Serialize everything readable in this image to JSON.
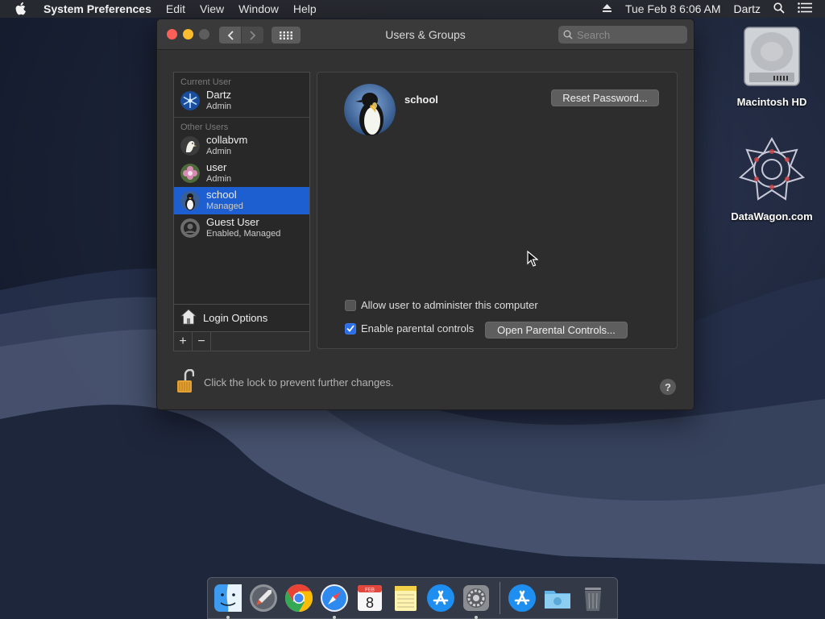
{
  "menubar": {
    "app_name": "System Preferences",
    "menus": [
      "Edit",
      "View",
      "Window",
      "Help"
    ],
    "datetime": "Tue Feb 8  6:06 AM",
    "username": "Dartz"
  },
  "window": {
    "title": "Users & Groups",
    "search_placeholder": "Search"
  },
  "sidebar": {
    "current_header": "Current User",
    "current_user": {
      "name": "Dartz",
      "role": "Admin"
    },
    "other_header": "Other Users",
    "other_users": [
      {
        "name": "collabvm",
        "role": "Admin"
      },
      {
        "name": "user",
        "role": "Admin"
      },
      {
        "name": "school",
        "role": "Managed"
      },
      {
        "name": "Guest User",
        "role": "Enabled, Managed"
      }
    ],
    "login_options": "Login Options",
    "add_label": "+",
    "remove_label": "−"
  },
  "detail": {
    "user_name": "school",
    "reset_password": "Reset Password...",
    "allow_admin_label": "Allow user to administer this computer",
    "allow_admin_checked": false,
    "parental_label": "Enable parental controls",
    "parental_checked": true,
    "open_parental": "Open Parental Controls..."
  },
  "lock": {
    "text": "Click the lock to prevent further changes."
  },
  "help": "?",
  "desktop": {
    "icons": [
      {
        "label": "Macintosh HD"
      },
      {
        "label": "DataWagon.com"
      }
    ]
  },
  "dock": {
    "items": [
      "finder-icon",
      "launchpad-icon",
      "chrome-icon",
      "safari-icon",
      "calendar-icon",
      "notes-icon",
      "app-store-icon",
      "system-preferences-icon",
      "app-store-icon",
      "downloads-folder-icon",
      "trash-icon"
    ],
    "calendar_month": "FEB",
    "calendar_day": "8"
  },
  "colors": {
    "selection": "#1d5fd0",
    "checkbox_on": "#2c6ee8",
    "close": "#fc5f57",
    "minimize": "#fdbc2e"
  }
}
